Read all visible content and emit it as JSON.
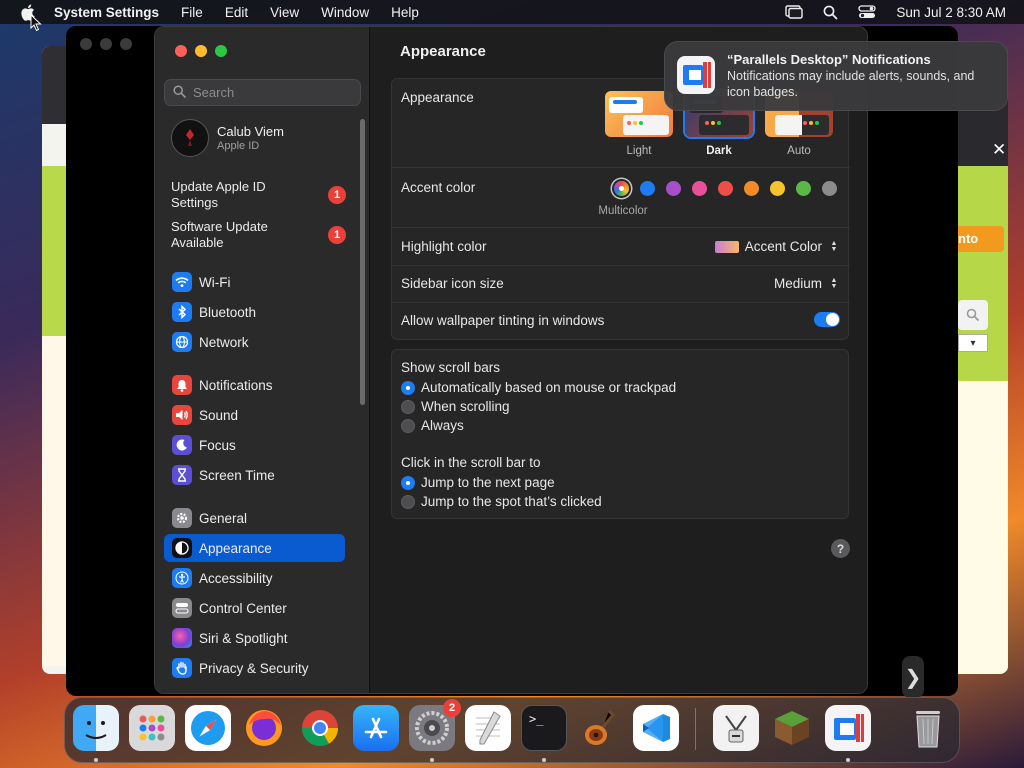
{
  "menubar": {
    "app_name": "System Settings",
    "menus": [
      "File",
      "Edit",
      "View",
      "Window",
      "Help"
    ],
    "clock": "Sun Jul 2  8:30 AM"
  },
  "background": {
    "right_button_label": "nto",
    "close_glyph": "✕"
  },
  "sidebar": {
    "search_placeholder": "Search",
    "account": {
      "name": "Calub Viem",
      "subtitle": "Apple ID"
    },
    "notices": [
      {
        "label": "Update Apple ID Settings",
        "badge": "1"
      },
      {
        "label": "Software Update Available",
        "badge": "1"
      }
    ],
    "items": [
      {
        "label": "Wi-Fi",
        "icon": "wifi-icon",
        "color": "#1e7cf2"
      },
      {
        "label": "Bluetooth",
        "icon": "bluetooth-icon",
        "color": "#1e7cf2"
      },
      {
        "label": "Network",
        "icon": "globe-icon",
        "color": "#1e7cf2"
      },
      {
        "label": "Notifications",
        "icon": "bell-icon",
        "color": "#e8453c"
      },
      {
        "label": "Sound",
        "icon": "speaker-icon",
        "color": "#e8453c"
      },
      {
        "label": "Focus",
        "icon": "moon-icon",
        "color": "#5b4fd6"
      },
      {
        "label": "Screen Time",
        "icon": "hourglass-icon",
        "color": "#5b4fd6"
      },
      {
        "label": "General",
        "icon": "gear-icon",
        "color": "#8a8a8e"
      },
      {
        "label": "Appearance",
        "icon": "appearance-icon",
        "color": "#111111",
        "active": true
      },
      {
        "label": "Accessibility",
        "icon": "accessibility-icon",
        "color": "#1e7cf2"
      },
      {
        "label": "Control Center",
        "icon": "control-center-icon",
        "color": "#8a8a8e"
      },
      {
        "label": "Siri & Spotlight",
        "icon": "siri-icon",
        "color": "#7a3fd6"
      },
      {
        "label": "Privacy & Security",
        "icon": "hand-icon",
        "color": "#1e7cf2"
      }
    ]
  },
  "main": {
    "title": "Appearance",
    "appearance": {
      "label": "Appearance",
      "options": [
        {
          "label": "Light"
        },
        {
          "label": "Dark",
          "selected": true
        },
        {
          "label": "Auto"
        }
      ]
    },
    "accent": {
      "label": "Accent color",
      "caption": "Multicolor",
      "colors": [
        "#1e7cf2",
        "#a550c8",
        "#ec4f9a",
        "#ee4d49",
        "#f28a28",
        "#f7c22a",
        "#5ab946",
        "#8c8c8c"
      ]
    },
    "highlight": {
      "label": "Highlight color",
      "value": "Accent Color"
    },
    "sidebar_icon": {
      "label": "Sidebar icon size",
      "value": "Medium"
    },
    "tinting": {
      "label": "Allow wallpaper tinting in windows",
      "on": true
    },
    "scroll": {
      "title": "Show scroll bars",
      "options": [
        {
          "label": "Automatically based on mouse or trackpad",
          "selected": true
        },
        {
          "label": "When scrolling",
          "selected": false
        },
        {
          "label": "Always",
          "selected": false
        }
      ]
    },
    "click": {
      "title": "Click in the scroll bar to",
      "options": [
        {
          "label": "Jump to the next page",
          "selected": true
        },
        {
          "label": "Jump to the spot that’s clicked",
          "selected": false
        }
      ]
    },
    "help": "?"
  },
  "notification": {
    "title": "“Parallels Desktop” Notifications",
    "body": "Notifications may include alerts, sounds, and icon badges."
  },
  "dock": {
    "apps": [
      {
        "name": "finder-icon",
        "running": true
      },
      {
        "name": "launchpad-icon",
        "running": false
      },
      {
        "name": "safari-icon",
        "running": false
      },
      {
        "name": "firefox-icon",
        "running": false
      },
      {
        "name": "chrome-icon",
        "running": false
      },
      {
        "name": "app-store-icon",
        "running": false
      },
      {
        "name": "system-settings-icon",
        "running": true,
        "badge": "2"
      },
      {
        "name": "textedit-icon",
        "running": false
      },
      {
        "name": "terminal-icon",
        "running": true
      },
      {
        "name": "garageband-icon",
        "running": false
      },
      {
        "name": "vscode-icon",
        "running": false
      },
      {
        "name": "archive-utility-icon",
        "running": false
      },
      {
        "name": "minecraft-icon",
        "running": false
      },
      {
        "name": "parallels-icon",
        "running": true
      },
      {
        "name": "trash-icon",
        "running": false
      }
    ]
  }
}
